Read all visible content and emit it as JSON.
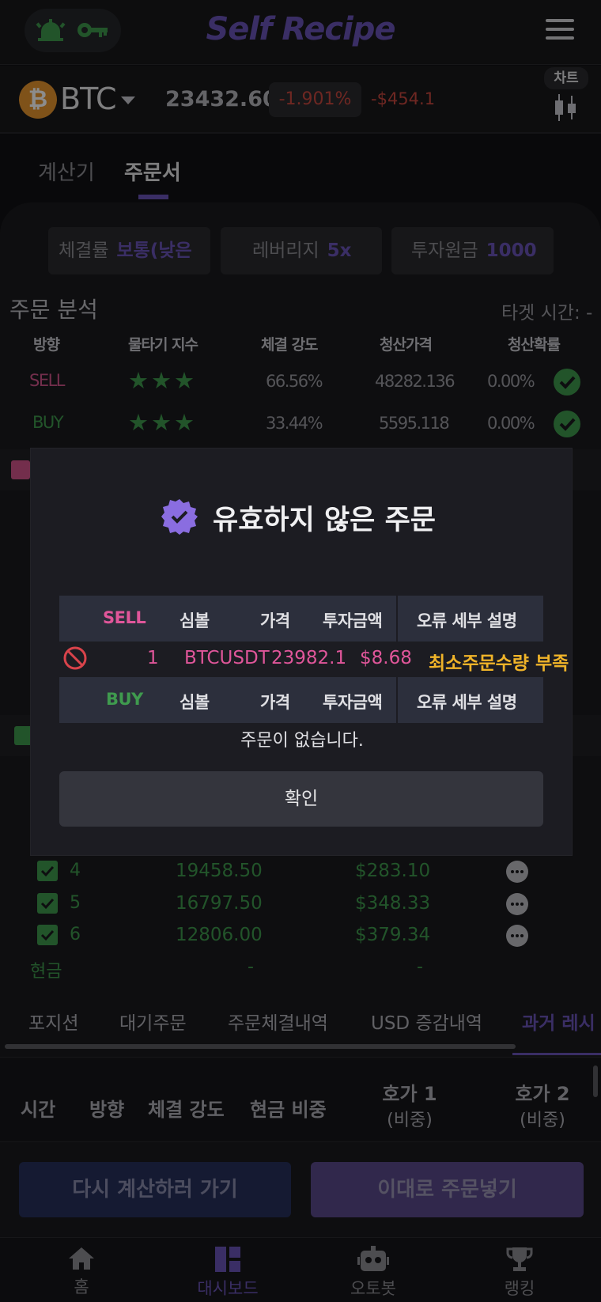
{
  "header": {
    "brand": "Self Recipe",
    "icons": [
      "alarm-icon",
      "key-icon",
      "menu-icon"
    ]
  },
  "ticker": {
    "symbol": "BTC",
    "price": "23432.60",
    "change_pct": "-1.901%",
    "change_usd": "-$454.1",
    "chart_label": "차트"
  },
  "tabs": [
    "계산기",
    "주문서"
  ],
  "chips": [
    {
      "key": "체결률",
      "value": "보통(낮은"
    },
    {
      "key": "레버리지",
      "value": "5x"
    },
    {
      "key": "투자원금",
      "value": "1000"
    }
  ],
  "analysis": {
    "title": "주문 분석",
    "target": "타겟 시간: -",
    "headers": [
      "방향",
      "물타기 지수",
      "체결 강도",
      "청산가격",
      "청산확률"
    ],
    "rows": [
      {
        "side": "SELL",
        "stars": "★★★",
        "strength": "66.56%",
        "liq_price": "48282.136",
        "liq_prob": "0.00%"
      },
      {
        "side": "BUY",
        "stars": "★★★",
        "strength": "33.44%",
        "liq_price": "5595.118",
        "liq_prob": "0.00%"
      }
    ]
  },
  "modal": {
    "title": "유효하지 않은 주문",
    "sell_header": [
      "SELL",
      "심볼",
      "가격",
      "투자금액",
      "오류 세부 설명"
    ],
    "sell_row": {
      "no": "1",
      "symbol": "BTCUSDT",
      "price": "23982.1",
      "amount": "$8.68",
      "error": "최소주문수량 부족"
    },
    "buy_header": [
      "BUY",
      "심볼",
      "가격",
      "투자금액",
      "오류 세부 설명"
    ],
    "empty": "주문이 없습니다.",
    "confirm": "확인"
  },
  "orders": [
    {
      "no": "4",
      "price": "19458.50",
      "amount": "$283.10"
    },
    {
      "no": "5",
      "price": "16797.50",
      "amount": "$348.33"
    },
    {
      "no": "6",
      "price": "12806.00",
      "amount": "$379.34"
    }
  ],
  "cash": {
    "label": "현금",
    "price": "-",
    "amount": "-"
  },
  "bottom_tabs": [
    "포지션",
    "대기주문",
    "주문체결내역",
    "USD 증감내역",
    "과거 레시"
  ],
  "table2_headers": [
    "시간",
    "방향",
    "체결 강도",
    "현금 비중",
    "호가 1",
    "(비중)",
    "호가 2",
    "(비중)"
  ],
  "buttons": {
    "recalc": "다시 계산하러 가기",
    "place": "이대로 주문넣기"
  },
  "nav": [
    "홈",
    "대시보드",
    "오토봇",
    "랭킹"
  ],
  "colors": {
    "accent": "#6b55b8",
    "sell": "#d2558b",
    "buy": "#3f9a4e",
    "error": "#f0b429",
    "down": "#c8473f"
  }
}
